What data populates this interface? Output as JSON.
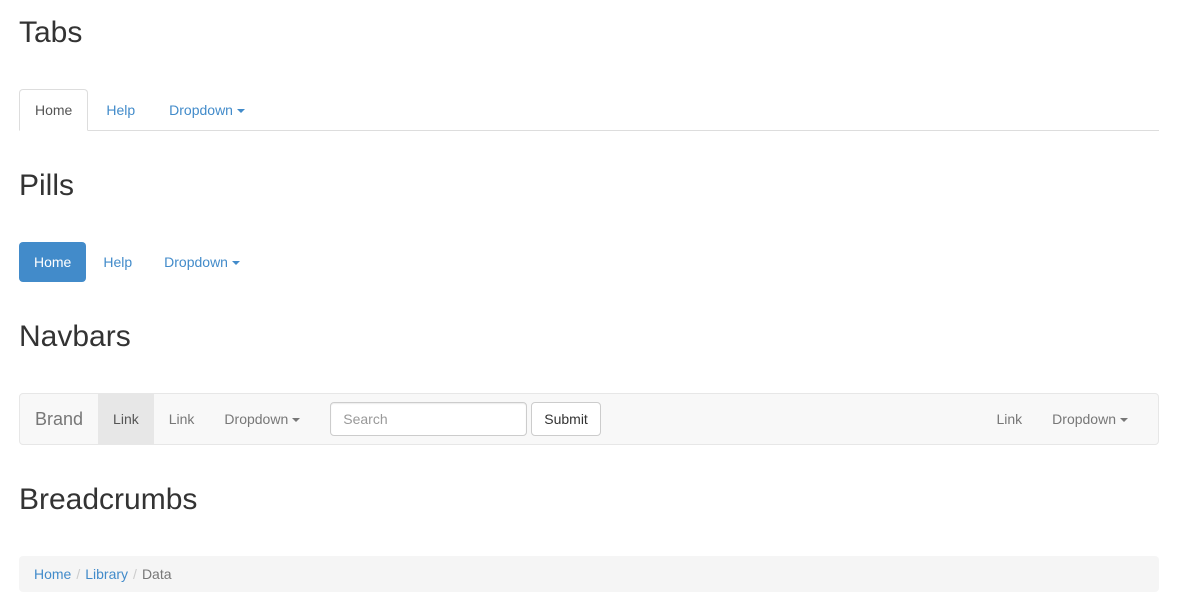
{
  "sections": {
    "tabs_title": "Tabs",
    "pills_title": "Pills",
    "navbars_title": "Navbars",
    "breadcrumbs_title": "Breadcrumbs"
  },
  "tabs": [
    {
      "label": "Home",
      "active": true
    },
    {
      "label": "Help",
      "active": false
    },
    {
      "label": "Dropdown",
      "active": false,
      "dropdown": true
    }
  ],
  "pills": [
    {
      "label": "Home",
      "active": true
    },
    {
      "label": "Help",
      "active": false
    },
    {
      "label": "Dropdown",
      "active": false,
      "dropdown": true
    }
  ],
  "navbar": {
    "brand": "Brand",
    "left_links": [
      {
        "label": "Link",
        "active": true
      },
      {
        "label": "Link",
        "active": false
      },
      {
        "label": "Dropdown",
        "active": false,
        "dropdown": true
      }
    ],
    "search": {
      "value": "",
      "placeholder": "Search"
    },
    "submit_label": "Submit",
    "right_links": [
      {
        "label": "Link"
      },
      {
        "label": "Dropdown",
        "dropdown": true
      }
    ]
  },
  "breadcrumb": {
    "items": [
      "Home",
      "Library",
      "Data"
    ],
    "separator": "/"
  },
  "colors": {
    "primary": "#428bca",
    "text": "#333333",
    "muted": "#777777",
    "navbar_bg": "#f8f8f8",
    "breadcrumb_bg": "#f5f5f5"
  }
}
